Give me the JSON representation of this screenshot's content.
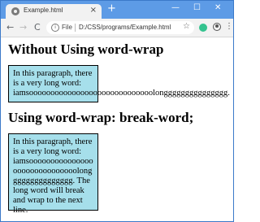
{
  "browser": {
    "tab_title": "Example.html",
    "tab_close": "×",
    "new_tab": "+",
    "window_controls": {
      "minimize": "—",
      "maximize": "☐",
      "close": "✕"
    },
    "nav": {
      "back": "←",
      "forward": "→",
      "reload": "C"
    },
    "omnibox": {
      "info": "i",
      "scheme": "File",
      "url": "D:/CSS/programs/Example.html"
    },
    "star": "☆",
    "menu": "⋮"
  },
  "page": {
    "heading_a": "Without Using word-wrap",
    "para_a_lines": [
      "In this paragraph, there",
      "is a very long word:",
      "iamsooooooooooooooooooooooooooooolonggggggggggggggg."
    ],
    "heading_b": "Using word-wrap: break-word;",
    "para_b": "In this paragraph, there is a very long word: iamsoooooooooooooooooooooooooooooolonggggggggggggggg. The long word will break and wrap to the next line."
  },
  "colors": {
    "tabbar": "#5d9be6",
    "para_bg": "#a6dfeb"
  }
}
